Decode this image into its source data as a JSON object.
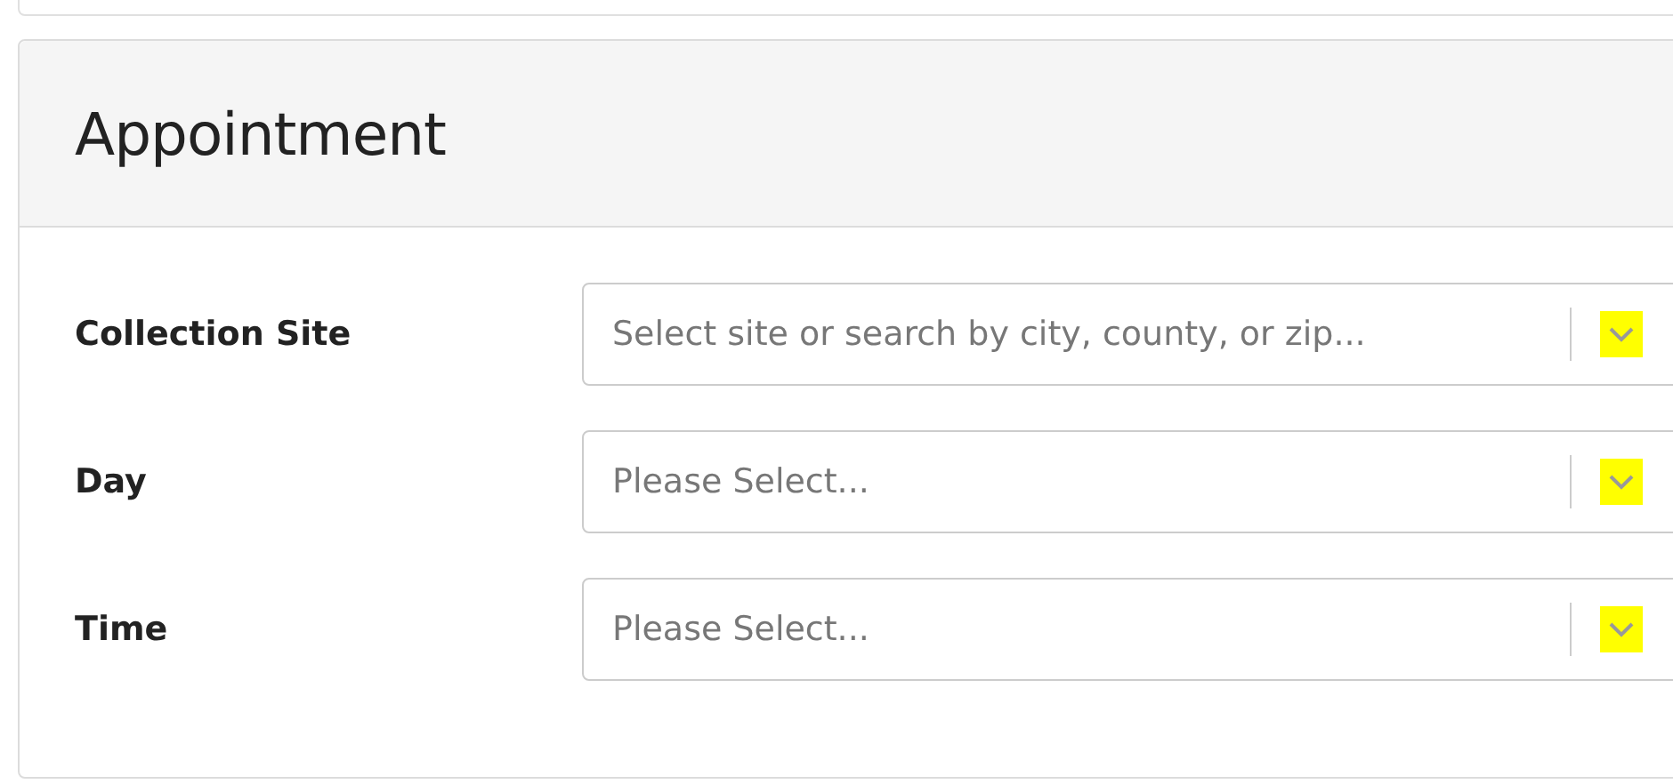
{
  "panel": {
    "title": "Appointment"
  },
  "fields": [
    {
      "label": "Collection Site",
      "placeholder": "Select site or search by city, county, or zip...",
      "highlighted": true
    },
    {
      "label": "Day",
      "placeholder": "Please Select...",
      "highlighted": true
    },
    {
      "label": "Time",
      "placeholder": "Please Select...",
      "highlighted": true
    }
  ]
}
